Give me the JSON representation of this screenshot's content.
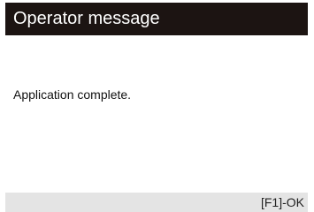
{
  "dialog": {
    "title": "Operator message",
    "message": "Application complete.",
    "softkeys": {
      "ok_label": "[F1]-OK"
    }
  },
  "colors": {
    "title_bar_bg": "#1c1412",
    "title_text": "#ffffff",
    "content_bg": "#ffffff",
    "softkey_bar_bg": "#e4e4e4",
    "text": "#111111"
  }
}
